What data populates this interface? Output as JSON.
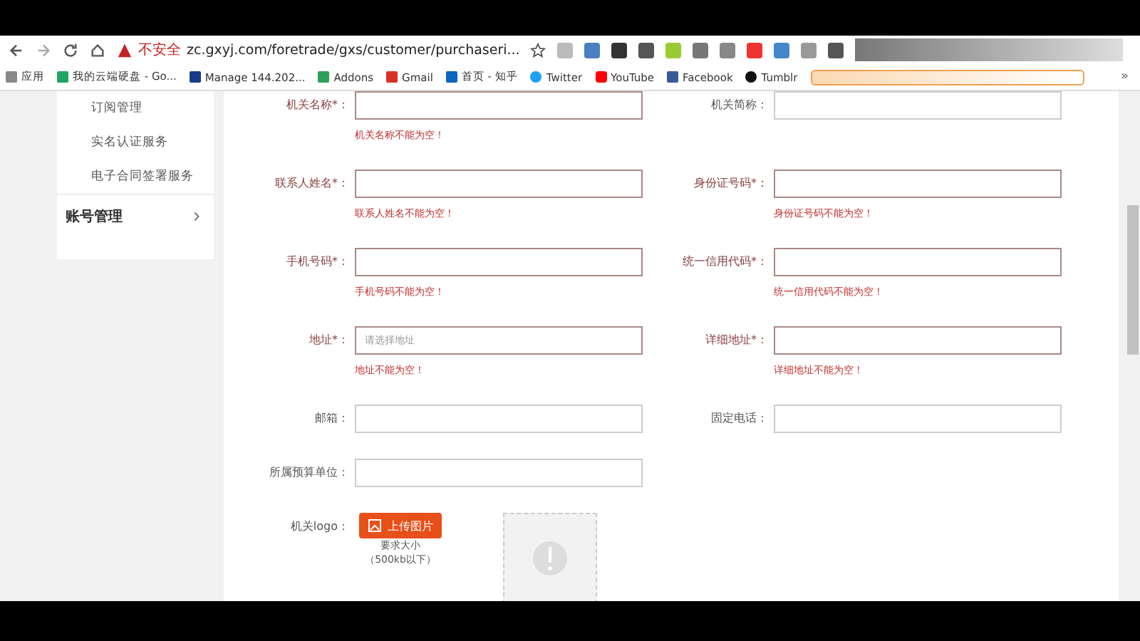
{
  "browser": {
    "security_label": "不安全",
    "url": "zc.gxyj.com/foretrade/gxs/customer/purchaseri...",
    "bookmarks": [
      {
        "label": "应用",
        "kind": "apps"
      },
      {
        "label": "我的云端硬盘 - Go...",
        "kind": "drive"
      },
      {
        "label": "Manage 144.202...",
        "kind": "v"
      },
      {
        "label": "Addons",
        "kind": "addons"
      },
      {
        "label": "Gmail",
        "kind": "gmail"
      },
      {
        "label": "首页 - 知乎",
        "kind": "zhihu"
      },
      {
        "label": "Twitter",
        "kind": "twitter"
      },
      {
        "label": "YouTube",
        "kind": "youtube"
      },
      {
        "label": "Facebook",
        "kind": "facebook"
      },
      {
        "label": "Tumblr",
        "kind": "tumblr"
      }
    ],
    "more": "»"
  },
  "sidebar": {
    "items": [
      {
        "label": "订阅管理"
      },
      {
        "label": "实名认证服务"
      },
      {
        "label": "电子合同签署服务"
      }
    ],
    "section": {
      "label": "账号管理"
    }
  },
  "form": {
    "rows": [
      {
        "fields": [
          {
            "label": "机关名称*：",
            "invalid": true,
            "error": "机关名称不能为空！"
          },
          {
            "label": "机关简称：",
            "invalid": false
          }
        ]
      },
      {
        "fields": [
          {
            "label": "联系人姓名*：",
            "invalid": true,
            "error": "联系人姓名不能为空！"
          },
          {
            "label": "身份证号码*：",
            "invalid": true,
            "error": "身份证号码不能为空！"
          }
        ]
      },
      {
        "fields": [
          {
            "label": "手机号码*：",
            "invalid": true,
            "error": "手机号码不能为空！"
          },
          {
            "label": "统一信用代码*：",
            "invalid": true,
            "error": "统一信用代码不能为空！"
          }
        ]
      },
      {
        "fields": [
          {
            "label": "地址*：",
            "invalid": true,
            "placeholder": "请选择地址",
            "error": "地址不能为空！"
          },
          {
            "label": "详细地址*：",
            "invalid": true,
            "error": "详细地址不能为空！"
          }
        ]
      },
      {
        "fields": [
          {
            "label": "邮箱：",
            "invalid": false
          },
          {
            "label": "固定电话：",
            "invalid": false
          }
        ]
      },
      {
        "fields": [
          {
            "label": "所属预算单位：",
            "invalid": false
          }
        ]
      }
    ],
    "logo": {
      "label": "机关logo：",
      "button": "上传图片",
      "hint": "要求大小",
      "hint_size": "（500kb以下）"
    }
  }
}
